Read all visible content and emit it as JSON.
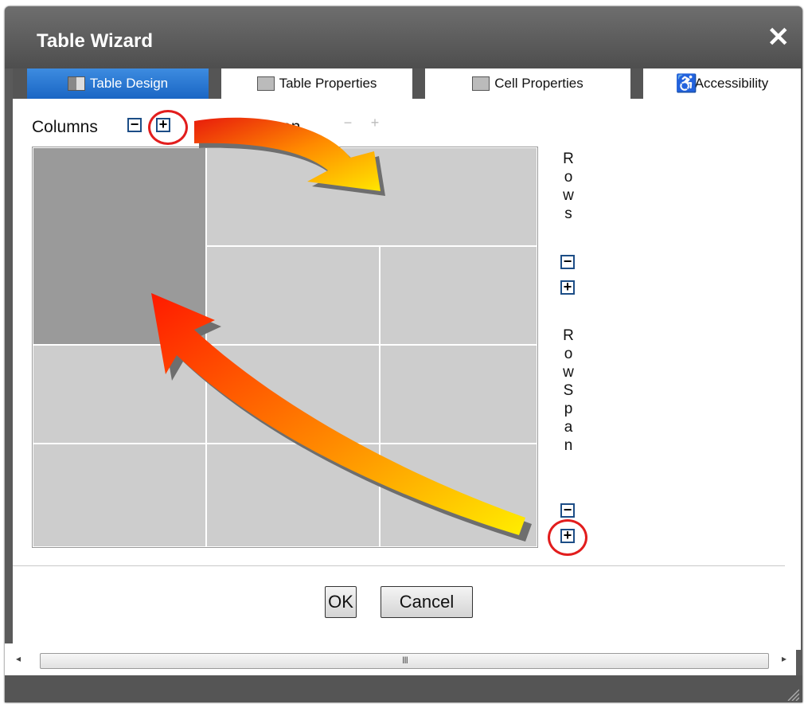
{
  "dialog": {
    "title": "Table Wizard",
    "close_icon": "close-icon"
  },
  "tabs": [
    {
      "label": "Table Design",
      "icon": "table-design-icon",
      "active": true
    },
    {
      "label": "Table Properties",
      "icon": "table-properties-icon",
      "active": false
    },
    {
      "label": "Cell Properties",
      "icon": "cell-properties-icon",
      "active": false
    },
    {
      "label": "Accessibility",
      "icon": "accessibility-icon",
      "active": false
    }
  ],
  "controls": {
    "columns_label": "Columns",
    "colspan_label": "ColumnSpan",
    "minus": "−",
    "plus": "+",
    "dim_minus": "−",
    "dim_plus": "+",
    "rows_label": [
      "R",
      "o",
      "w",
      "s"
    ],
    "rowspan_label": [
      "R",
      "o",
      "w",
      "S",
      "p",
      "a",
      "n"
    ]
  },
  "grid": {
    "columns": 3,
    "rows": 4,
    "selected_cell": {
      "row": 1,
      "col": 1,
      "rowspan": 2
    }
  },
  "buttons": {
    "ok": "OK",
    "cancel": "Cancel"
  },
  "scrollbar": {
    "left_arrow": "◂",
    "right_arrow": "▸",
    "grip": "III"
  },
  "colors": {
    "accent": "#1a66c4",
    "titlebar": "#5a5a5a",
    "cell": "#cdcdcd",
    "selected_cell": "#9a9a9a",
    "highlight_circle": "#e21d1d"
  }
}
